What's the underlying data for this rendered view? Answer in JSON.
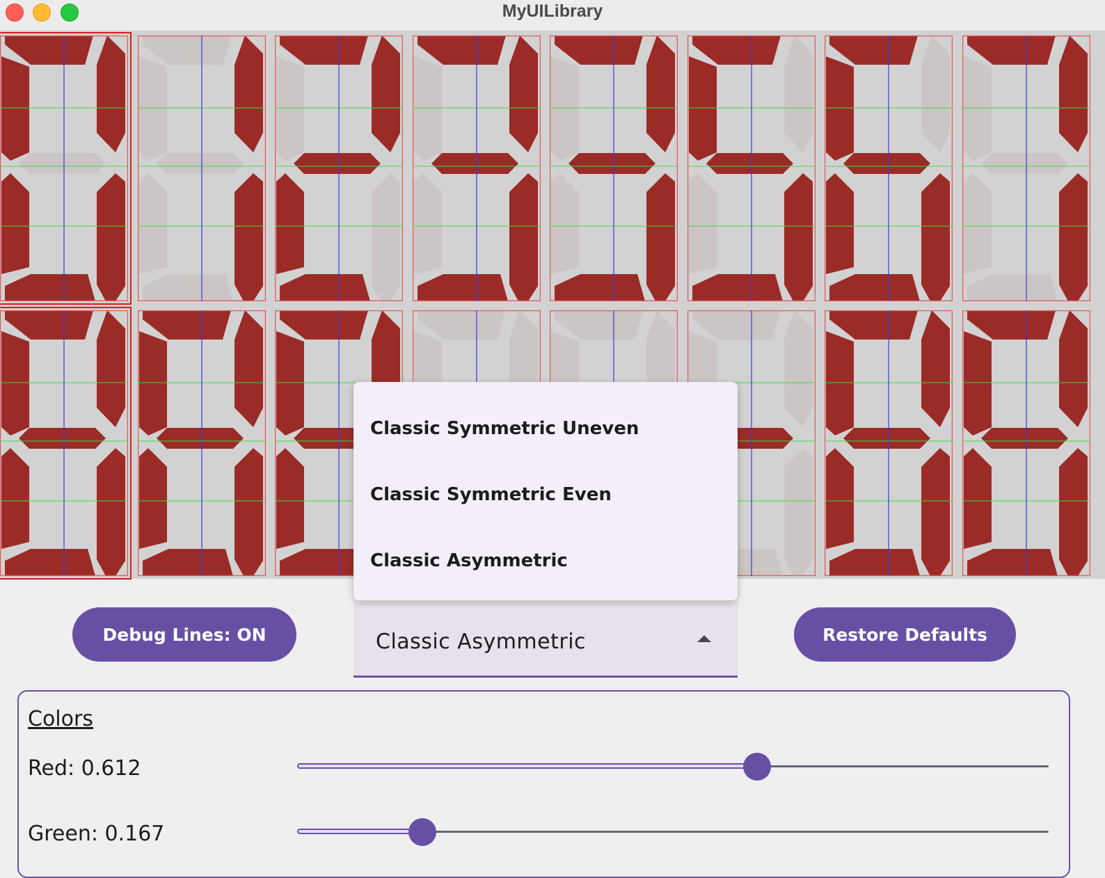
{
  "window": {
    "title": "MyUILibrary",
    "buttons": [
      "close",
      "minimize",
      "zoom"
    ]
  },
  "display": {
    "segment_on_color": "#9b2b27",
    "segment_off_color": "#cbc5c5",
    "background_color": "#d2d2d2",
    "debug_lines": true,
    "rows": [
      {
        "digits": [
          "0",
          "1",
          "2",
          "3",
          "3",
          "5",
          "6",
          "7"
        ],
        "selected_index": 0
      },
      {
        "digits": [
          "8",
          "8",
          "8",
          "-",
          "-",
          "-",
          "8",
          "8"
        ],
        "selected_index": 0
      }
    ]
  },
  "controls": {
    "debug_button_label": "Debug Lines: ON",
    "restore_button_label": "Restore Defaults",
    "style_select": {
      "selected": "Classic Asymmetric",
      "options": [
        "Classic Symmetric Uneven",
        "Classic Symmetric Even",
        "Classic Asymmetric"
      ],
      "expanded": true,
      "arrow_icon": "arrow-up-icon"
    }
  },
  "colors_panel": {
    "title": "Colors",
    "sliders": [
      {
        "label": "Red: 0.612",
        "value": 0.612
      },
      {
        "label": "Green: 0.167",
        "value": 0.167
      }
    ]
  },
  "accent_color": "#6750a4"
}
